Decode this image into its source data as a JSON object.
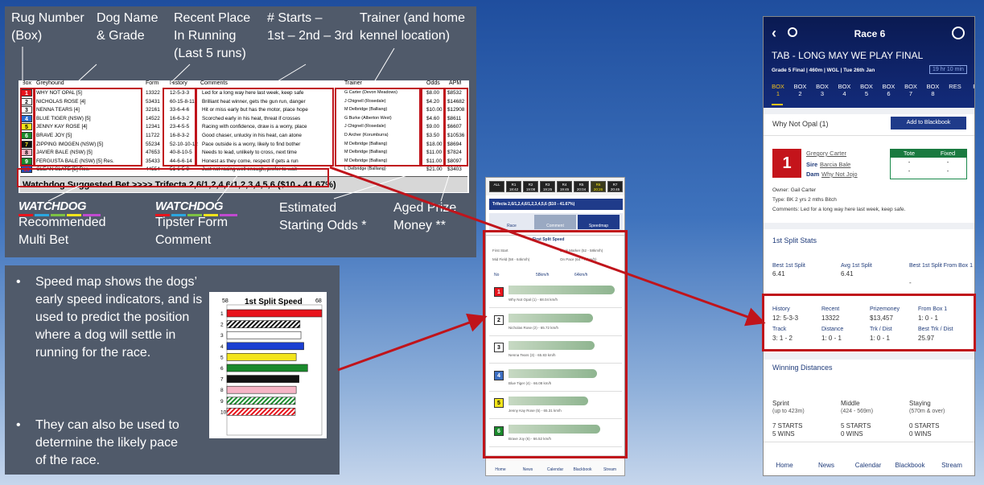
{
  "form_panel": {
    "labels": {
      "rug": "Rug Number\n(Box)",
      "dog": "Dog Name\n& Grade",
      "place": "Recent Place\nIn Running\n(Last 5 runs)",
      "starts_title": "# Starts –",
      "starts_line": "1st – 2nd – 3rd",
      "trainer": "Trainer (and home\nkennel location)",
      "bet": "Recommended\nMulti Bet",
      "tip": "Tipster Form\nComment",
      "odds": "Estimated\nStarting Odds *",
      "prize": "Aged Prize\nMoney **"
    },
    "logo_text": "WATCHDOG",
    "headers": {
      "box": "Box",
      "greyhound": "Greyhound",
      "form": "Form",
      "history": "History",
      "comments": "Comments",
      "trainer": "Trainer",
      "odds": "Odds",
      "apm": "APM"
    },
    "rows": [
      {
        "box": "1",
        "name": "WHY NOT OPAL [5]",
        "form": "13322",
        "history": "12-5-3-3",
        "comment": "Led for a long way here last week, keep safe",
        "trainer": "G Carter (Devon Meadows)",
        "odds": "$8.00",
        "apm": "$8532",
        "bg": "#e8141c",
        "fg": "#fff"
      },
      {
        "box": "2",
        "name": "NICHOLAS ROSE [4]",
        "form": "53431",
        "history": "60-15-8-11",
        "comment": "Brilliant heat winner, gets the gun run, danger",
        "trainer": "J Chignell (Rosedale)",
        "odds": "$4.20",
        "apm": "$14682",
        "bg": "#fff",
        "fg": "#000"
      },
      {
        "box": "3",
        "name": "NENNA TEARS [4]",
        "form": "32161",
        "history": "33-6-4-6",
        "comment": "Hit or miss early but has the motor, place hope",
        "trainer": "M Delbridge (Balliang)",
        "odds": "$10.00",
        "apm": "$12908",
        "bg": "#fff",
        "fg": "#000"
      },
      {
        "box": "4",
        "name": "BLUE TIGER (NSW) [5]",
        "form": "14522",
        "history": "16-6-3-2",
        "comment": "Scorched early in his heat, threat if crosses",
        "trainer": "G Burke (Alberton West)",
        "odds": "$4.60",
        "apm": "$8611",
        "bg": "#2a6fd1",
        "fg": "#fff"
      },
      {
        "box": "5",
        "name": "JENNY KAY ROSE [4]",
        "form": "12341",
        "history": "23-4-5-5",
        "comment": "Racing with confidence, draw is a worry, place",
        "trainer": "J Chignell (Rosedale)",
        "odds": "$9.00",
        "apm": "$6607",
        "bg": "#f3e51b",
        "fg": "#000"
      },
      {
        "box": "6",
        "name": "BRAVE JOY [5]",
        "form": "11722",
        "history": "16-8-3-2",
        "comment": "Good chaser, unlucky in his heat, can atone",
        "trainer": "D Archer (Korumburra)",
        "odds": "$3.50",
        "apm": "$10536",
        "bg": "#1a8a2c",
        "fg": "#fff"
      },
      {
        "box": "7",
        "name": "ZIPPING IMOGEN (NSW) [5]",
        "form": "55234",
        "history": "52-10-10-12",
        "comment": "Pace outside is a worry, likely to find bother",
        "trainer": "M Delbridge (Balliang)",
        "odds": "$18.00",
        "apm": "$8694",
        "bg": "#111",
        "fg": "#f3e51b"
      },
      {
        "box": "8",
        "name": "JAVIER BALE (NSW) [5]",
        "form": "47653",
        "history": "40-8-10-5",
        "comment": "Needs to lead, unlikely to cross, next time",
        "trainer": "M Delbridge (Balliang)",
        "odds": "$11.00",
        "apm": "$7824",
        "bg": "#f6b6c6",
        "fg": "#000"
      },
      {
        "box": "9",
        "name": "FERGUSTA BALE (NSW) [5] Res.",
        "form": "35433",
        "history": "44-6-6-14",
        "comment": "Honest as they come, respect if gets a run",
        "trainer": "M Delbridge (Balliang)",
        "odds": "$11.00",
        "apm": "$8097",
        "bg": "#1a8a2c",
        "fg": "#fff"
      },
      {
        "box": "10",
        "name": "CLEAN SLATE [5] Res.",
        "form": "44554",
        "history": "51-6-5-9",
        "comment": "Just not racing well enough, prefer to wait",
        "trainer": "L Delbridge (Balliang)",
        "odds": "$21.00",
        "apm": "$3403",
        "bg": "#1b4fc4",
        "fg": "#e8141c"
      }
    ],
    "suggested_bet": "Watchdog Suggested Bet >>>> Trifecta 2,6/1,2,4,6/1,2,3,4,5,6 ($10 - 41.67%)"
  },
  "speed_panel": {
    "bullets": [
      "Speed map shows the dogs’ early speed indicators, and is used to predict the position where a dog will settle in running for the race.",
      "They can also be used to determine the likely pace of the race."
    ],
    "chart": {
      "title": "1st Split Speed",
      "min_label": "58",
      "max_label": "68"
    }
  },
  "chart_data": {
    "type": "bar",
    "title": "1st Split Speed",
    "categories": [
      "1",
      "2",
      "3",
      "4",
      "5",
      "6",
      "7",
      "8",
      "9",
      "10"
    ],
    "values": [
      68.0,
      65.7,
      65.8,
      66.1,
      65.3,
      66.5,
      65.6,
      65.3,
      65.2,
      65.2
    ],
    "xlim": [
      58,
      68
    ],
    "colors": [
      "#e8141c",
      "hatch-black",
      "#fff",
      "#1b3fd1",
      "#f3e51b",
      "#1a8a2c",
      "#111",
      "#f6b6c6",
      "hatch-green",
      "hatch-red"
    ]
  },
  "phone": {
    "race_chips": [
      {
        "code": "ALL",
        "time": ""
      },
      {
        "code": "R1",
        "time": "18:42"
      },
      {
        "code": "R2",
        "time": "19:08"
      },
      {
        "code": "R3",
        "time": "19:25"
      },
      {
        "code": "R4",
        "time": "19:45"
      },
      {
        "code": "R5",
        "time": "20:04"
      },
      {
        "code": "R6",
        "time": "20:26"
      },
      {
        "code": "R7",
        "time": "20:45"
      }
    ],
    "bet_banner": "Trifecta 2,6/1,2,4,6/1,2,3,4,5,6 ($10 - 41.67%)",
    "tabs": [
      "Race",
      "Comment",
      "Speedmap"
    ],
    "speed_title": "First Split Speed",
    "legend": [
      "First Start",
      "Back Marker (52 - 58km/h)",
      "Mid Field (58 - 64km/h)",
      "On Pace (64 - 70km/h)"
    ],
    "axis": {
      "no": "No",
      "a": "58km/h",
      "b": "64km/h"
    },
    "rows": [
      {
        "box": "1",
        "name": "Why Not Opal (1) - 68.04 km/h",
        "bg": "#e8141c",
        "fg": "#fff",
        "pct": 0.88
      },
      {
        "box": "2",
        "name": "Nicholas Rose (2) - 65.72 km/h",
        "bg": "#fff",
        "fg": "#000",
        "pct": 0.7
      },
      {
        "box": "3",
        "name": "Nenna Tears (3) - 65.83 km/h",
        "bg": "#fff",
        "fg": "#000",
        "pct": 0.71
      },
      {
        "box": "4",
        "name": "Blue Tiger (4) - 66.08 km/h",
        "bg": "#3d6fc2",
        "fg": "#fff",
        "pct": 0.73
      },
      {
        "box": "5",
        "name": "Jenny Kay Rose (5) - 65.31 km/h",
        "bg": "#f3e51b",
        "fg": "#000",
        "pct": 0.66
      },
      {
        "box": "6",
        "name": "Brave Joy (6) - 66.52 km/h",
        "bg": "#1a8a2c",
        "fg": "#fff",
        "pct": 0.76
      }
    ],
    "nav": [
      "Home",
      "News",
      "Calendar",
      "Blackbook",
      "Stream"
    ]
  },
  "tablet": {
    "race": "Race 6",
    "title": "TAB - LONG MAY WE PLAY FINAL",
    "meta": "Grade 5 Final  |  460m  |  WGL  |  Tue 26th Jan",
    "countdown": "19 hr 10 min",
    "boxes": [
      "BOX\n1",
      "BOX\n2",
      "BOX\n3",
      "BOX\n4",
      "BOX\n5",
      "BOX\n6",
      "BOX\n7",
      "BOX\n8",
      "RES",
      "RE"
    ],
    "dog": "Why Not Opal (1)",
    "blackbook": "Add to Blackbook",
    "trainer_link": "Gregory Carter",
    "sire_lbl": "Sire",
    "sire": "Barcia Bale",
    "dam_lbl": "Dam",
    "dam": "Why Not Jojo",
    "tote": "Tote",
    "fixed": "Fixed",
    "dash": "-",
    "owner": "Owner: Gail Carter",
    "type": "Type: BK 2 yrs 2 mths Bitch",
    "comments": "Comments: Led for a long way here last week, keep safe.",
    "split_title": "1st Split Stats",
    "split": [
      {
        "k": "Best 1st Split",
        "v": "6.41"
      },
      {
        "k": "Avg 1st Split",
        "v": "6.41"
      },
      {
        "k": "Best 1st Split From Box 1",
        "v": "-"
      }
    ],
    "stats": [
      {
        "k": "History",
        "v": "12: 5-3-3"
      },
      {
        "k": "Recent",
        "v": "13322"
      },
      {
        "k": "Prizemoney",
        "v": "$13,457"
      },
      {
        "k": "From Box 1",
        "v": "1: 0 - 1"
      },
      {
        "k": "Track",
        "v": "3: 1 - 2"
      },
      {
        "k": "Distance",
        "v": "1: 0 - 1"
      },
      {
        "k": "Trk / Dist",
        "v": "1: 0 - 1"
      },
      {
        "k": "Best Trk / Dist",
        "v": "25.97"
      }
    ],
    "win_title": "Winning Distances",
    "wins": [
      {
        "k": "Sprint",
        "sub": "(up to 423m)",
        "s": "7 STARTS",
        "w": "5 WINS"
      },
      {
        "k": "Middle",
        "sub": "(424 - 569m)",
        "s": "5 STARTS",
        "w": "0 WINS"
      },
      {
        "k": "Staying",
        "sub": "(570m & over)",
        "s": "0 STARTS",
        "w": "0 WINS"
      }
    ],
    "nav": [
      "Home",
      "News",
      "Calendar",
      "Blackbook",
      "Stream"
    ]
  }
}
